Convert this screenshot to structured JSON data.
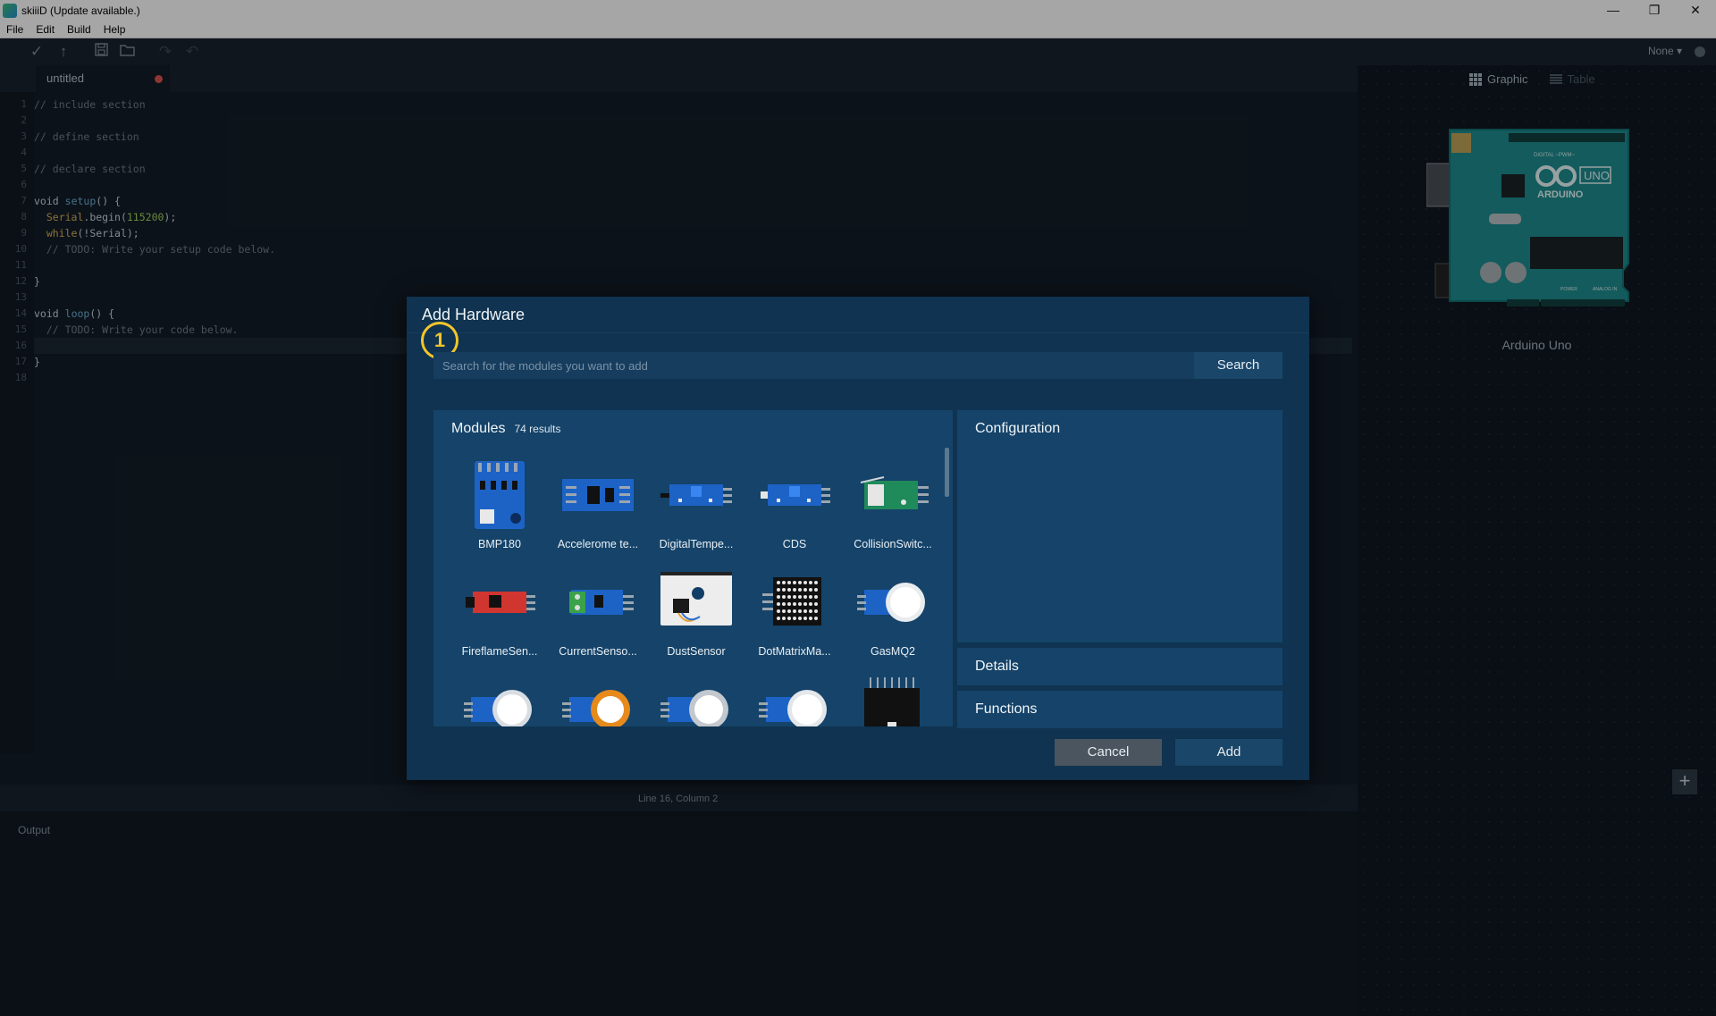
{
  "window": {
    "title": "skiiiD (Update available.)",
    "controls": [
      "—",
      "❐",
      "✕"
    ]
  },
  "menu": [
    "File",
    "Edit",
    "Build",
    "Help"
  ],
  "toolbar": {
    "board_select": "None ▾"
  },
  "editor": {
    "tab_name": "untitled",
    "status": "Line 16, Column 2",
    "line_numbers": [
      "1",
      "2",
      "3",
      "4",
      "5",
      "6",
      "7",
      "8",
      "9",
      "10",
      "11",
      "12",
      "13",
      "14",
      "15",
      "16",
      "17",
      "18"
    ],
    "lines": [
      "// include section",
      "",
      "// define section",
      "",
      "// declare section",
      "",
      "void setup() {",
      "  Serial.begin(115200);",
      "  while(!Serial);",
      "  // TODO: Write your setup code below.",
      "",
      "}",
      "",
      "void loop() {",
      "  // TODO: Write your code below.",
      "",
      "}",
      ""
    ],
    "tokens": {
      "void": "void",
      "setup": "setup",
      "loop": "loop",
      "paren_open": "() {",
      "serial": "Serial",
      "begin": ".begin(",
      "baud": "115200",
      "close_semi": ");",
      "while": "while",
      "while_arg": "(!Serial);"
    }
  },
  "output": {
    "label": "Output"
  },
  "right_panel": {
    "view_graphic": "Graphic",
    "view_table": "Table",
    "board_name": "Arduino Uno",
    "board_labels": {
      "brand": "ARDUINO",
      "model": "UNO",
      "digital": "DIGITAL ~PWM~",
      "power": "POWER",
      "analog": "ANALOG IN"
    },
    "add_button": "+"
  },
  "dialog": {
    "title": "Add Hardware",
    "step": "1",
    "search_placeholder": "Search for the modules you want to add",
    "search_button": "Search",
    "modules_title": "Modules",
    "modules_count": "74 results",
    "modules": [
      {
        "name": "BMP180",
        "icon": "bmp180-sensor-icon"
      },
      {
        "name": "Accelerome te...",
        "icon": "accelerometer-icon"
      },
      {
        "name": "DigitalTempe...",
        "icon": "digital-temperature-icon"
      },
      {
        "name": "CDS",
        "icon": "cds-icon"
      },
      {
        "name": "CollisionSwitc...",
        "icon": "collision-switch-icon"
      },
      {
        "name": "FireflameSen...",
        "icon": "flame-sensor-icon"
      },
      {
        "name": "CurrentSenso...",
        "icon": "current-sensor-icon"
      },
      {
        "name": "DustSensor",
        "icon": "dust-sensor-icon"
      },
      {
        "name": "DotMatrixMa...",
        "icon": "dot-matrix-icon"
      },
      {
        "name": "GasMQ2",
        "icon": "gas-sensor-icon"
      },
      {
        "name": "",
        "icon": "gas-sensor-icon"
      },
      {
        "name": "",
        "icon": "gas-sensor-orange-icon"
      },
      {
        "name": "",
        "icon": "gas-sensor-icon"
      },
      {
        "name": "",
        "icon": "gas-sensor-icon"
      },
      {
        "name": "",
        "icon": "ic-module-icon"
      }
    ],
    "config_title": "Configuration",
    "details_title": "Details",
    "functions_title": "Functions",
    "cancel_button": "Cancel",
    "add_button": "Add",
    "colors": {
      "dialog_bg": "#0f3350",
      "panel_bg": "#154369",
      "badge": "#f2c52b"
    }
  }
}
